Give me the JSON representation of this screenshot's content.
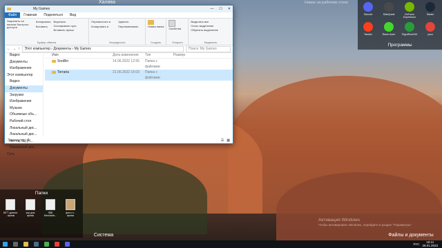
{
  "desktop": {
    "fence_top_left": "Халява",
    "fence_top_right": "Новое на рабочем столе",
    "fence_programs": "Программы",
    "fence_folders": "Папки",
    "fence_system": "Система",
    "fence_files": "Файлы и документы",
    "programs": [
      {
        "label": "Discord",
        "color": "#5865f2"
      },
      {
        "label": "SideQuest",
        "color": "#3a3a3a"
      },
      {
        "label": "GeForce Experience",
        "color": "#76b900"
      },
      {
        "label": "Steam",
        "color": "#1b2838"
      },
      {
        "label": "Yandex",
        "color": "#fc3f1d"
      },
      {
        "label": "Razer Axon",
        "color": "#111111"
      },
      {
        "label": "TegraRcmGUI",
        "color": "#2a9d3a"
      },
      {
        "label": "yuzu",
        "color": "#e0463c"
      }
    ],
    "folders": [
      {
        "label": "ЮГТ дитяли - ярлык"
      },
      {
        "label": "кор для ярлык"
      },
      {
        "label": "ЛКБ Mechanic..."
      },
      {
        "label": "фото н - ярлык"
      }
    ],
    "activation_title": "Активация Windows",
    "activation_text": "Чтобы активировать Windows, перейдите в раздел \"Параметры\"."
  },
  "window": {
    "title": "My Games",
    "tabs": [
      "Файл",
      "Главная",
      "Поделиться",
      "Вид"
    ],
    "ribbon": {
      "clipboard": {
        "items": [
          "Закрепить на панели быстрого доступа",
          "Копировать",
          "Вставить",
          "Вырезать",
          "Скопировать путь",
          "Вставить ярлык"
        ],
        "label": "Буфер обмена"
      },
      "organize": {
        "items": [
          "Переместить в",
          "Копировать в",
          "Удалить",
          "Переименовать"
        ],
        "label": "Упорядочить"
      },
      "new": {
        "items": [
          "Новая папка"
        ],
        "label": "Создать"
      },
      "open": {
        "items": [
          "Свойства"
        ],
        "label": "Открыть"
      },
      "select": {
        "items": [
          "Выделить все",
          "Снять выделение",
          "Обратить выделение"
        ],
        "label": "Выделить"
      }
    },
    "address": {
      "path": [
        "Этот компьютер",
        "Документы",
        "My Games"
      ],
      "search_placeholder": "Поиск: My Games"
    },
    "nav_items": [
      "Видео",
      "Документы",
      "Изображения",
      "Этот компьютер",
      "Видео",
      "Документы",
      "Загрузки",
      "Изображения",
      "Музыка",
      "Объемные объ...",
      "Рабочий стол",
      "Локальный дис...",
      "Локальный дис...",
      "нет г.ц. бц (Н...",
      "Локальный дис...",
      "Сеть"
    ],
    "columns": [
      "Имя",
      "Дата изменения",
      "Тип",
      "Размер"
    ],
    "files": [
      {
        "name": "SnoBin",
        "date": "14.06.2022 12:55",
        "type": "Папка с файлами",
        "size": ""
      },
      {
        "name": "Terraria",
        "date": "21.06.2022 16:03",
        "type": "Папка с файлами",
        "size": ""
      }
    ],
    "status": "Элементов: 2"
  },
  "taskbar": {
    "time": "19:11",
    "date": "28.01.2023",
    "lang": "РУС"
  }
}
